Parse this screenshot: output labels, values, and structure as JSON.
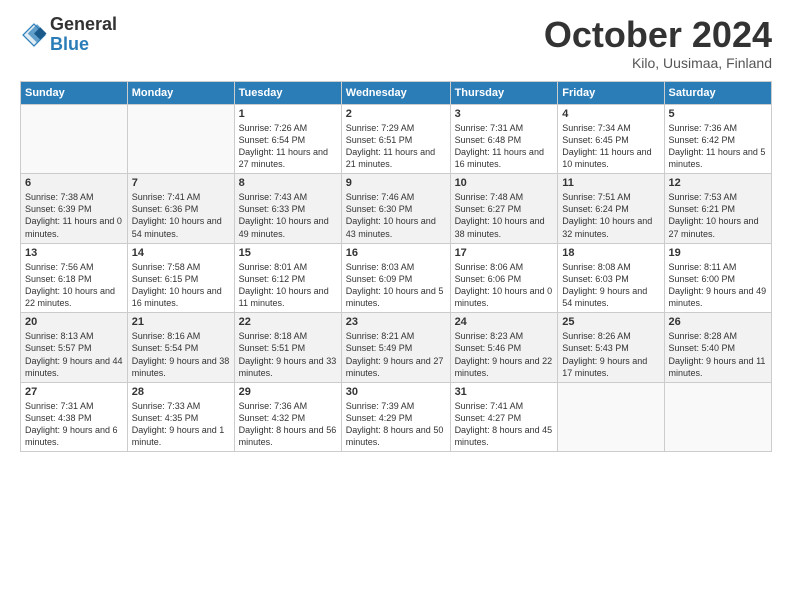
{
  "header": {
    "logo_general": "General",
    "logo_blue": "Blue",
    "month_title": "October 2024",
    "location": "Kilo, Uusimaa, Finland"
  },
  "weekdays": [
    "Sunday",
    "Monday",
    "Tuesday",
    "Wednesday",
    "Thursday",
    "Friday",
    "Saturday"
  ],
  "weeks": [
    [
      {
        "day": "",
        "info": ""
      },
      {
        "day": "",
        "info": ""
      },
      {
        "day": "1",
        "info": "Sunrise: 7:26 AM\nSunset: 6:54 PM\nDaylight: 11 hours and 27 minutes."
      },
      {
        "day": "2",
        "info": "Sunrise: 7:29 AM\nSunset: 6:51 PM\nDaylight: 11 hours and 21 minutes."
      },
      {
        "day": "3",
        "info": "Sunrise: 7:31 AM\nSunset: 6:48 PM\nDaylight: 11 hours and 16 minutes."
      },
      {
        "day": "4",
        "info": "Sunrise: 7:34 AM\nSunset: 6:45 PM\nDaylight: 11 hours and 10 minutes."
      },
      {
        "day": "5",
        "info": "Sunrise: 7:36 AM\nSunset: 6:42 PM\nDaylight: 11 hours and 5 minutes."
      }
    ],
    [
      {
        "day": "6",
        "info": "Sunrise: 7:38 AM\nSunset: 6:39 PM\nDaylight: 11 hours and 0 minutes."
      },
      {
        "day": "7",
        "info": "Sunrise: 7:41 AM\nSunset: 6:36 PM\nDaylight: 10 hours and 54 minutes."
      },
      {
        "day": "8",
        "info": "Sunrise: 7:43 AM\nSunset: 6:33 PM\nDaylight: 10 hours and 49 minutes."
      },
      {
        "day": "9",
        "info": "Sunrise: 7:46 AM\nSunset: 6:30 PM\nDaylight: 10 hours and 43 minutes."
      },
      {
        "day": "10",
        "info": "Sunrise: 7:48 AM\nSunset: 6:27 PM\nDaylight: 10 hours and 38 minutes."
      },
      {
        "day": "11",
        "info": "Sunrise: 7:51 AM\nSunset: 6:24 PM\nDaylight: 10 hours and 32 minutes."
      },
      {
        "day": "12",
        "info": "Sunrise: 7:53 AM\nSunset: 6:21 PM\nDaylight: 10 hours and 27 minutes."
      }
    ],
    [
      {
        "day": "13",
        "info": "Sunrise: 7:56 AM\nSunset: 6:18 PM\nDaylight: 10 hours and 22 minutes."
      },
      {
        "day": "14",
        "info": "Sunrise: 7:58 AM\nSunset: 6:15 PM\nDaylight: 10 hours and 16 minutes."
      },
      {
        "day": "15",
        "info": "Sunrise: 8:01 AM\nSunset: 6:12 PM\nDaylight: 10 hours and 11 minutes."
      },
      {
        "day": "16",
        "info": "Sunrise: 8:03 AM\nSunset: 6:09 PM\nDaylight: 10 hours and 5 minutes."
      },
      {
        "day": "17",
        "info": "Sunrise: 8:06 AM\nSunset: 6:06 PM\nDaylight: 10 hours and 0 minutes."
      },
      {
        "day": "18",
        "info": "Sunrise: 8:08 AM\nSunset: 6:03 PM\nDaylight: 9 hours and 54 minutes."
      },
      {
        "day": "19",
        "info": "Sunrise: 8:11 AM\nSunset: 6:00 PM\nDaylight: 9 hours and 49 minutes."
      }
    ],
    [
      {
        "day": "20",
        "info": "Sunrise: 8:13 AM\nSunset: 5:57 PM\nDaylight: 9 hours and 44 minutes."
      },
      {
        "day": "21",
        "info": "Sunrise: 8:16 AM\nSunset: 5:54 PM\nDaylight: 9 hours and 38 minutes."
      },
      {
        "day": "22",
        "info": "Sunrise: 8:18 AM\nSunset: 5:51 PM\nDaylight: 9 hours and 33 minutes."
      },
      {
        "day": "23",
        "info": "Sunrise: 8:21 AM\nSunset: 5:49 PM\nDaylight: 9 hours and 27 minutes."
      },
      {
        "day": "24",
        "info": "Sunrise: 8:23 AM\nSunset: 5:46 PM\nDaylight: 9 hours and 22 minutes."
      },
      {
        "day": "25",
        "info": "Sunrise: 8:26 AM\nSunset: 5:43 PM\nDaylight: 9 hours and 17 minutes."
      },
      {
        "day": "26",
        "info": "Sunrise: 8:28 AM\nSunset: 5:40 PM\nDaylight: 9 hours and 11 minutes."
      }
    ],
    [
      {
        "day": "27",
        "info": "Sunrise: 7:31 AM\nSunset: 4:38 PM\nDaylight: 9 hours and 6 minutes."
      },
      {
        "day": "28",
        "info": "Sunrise: 7:33 AM\nSunset: 4:35 PM\nDaylight: 9 hours and 1 minute."
      },
      {
        "day": "29",
        "info": "Sunrise: 7:36 AM\nSunset: 4:32 PM\nDaylight: 8 hours and 56 minutes."
      },
      {
        "day": "30",
        "info": "Sunrise: 7:39 AM\nSunset: 4:29 PM\nDaylight: 8 hours and 50 minutes."
      },
      {
        "day": "31",
        "info": "Sunrise: 7:41 AM\nSunset: 4:27 PM\nDaylight: 8 hours and 45 minutes."
      },
      {
        "day": "",
        "info": ""
      },
      {
        "day": "",
        "info": ""
      }
    ]
  ]
}
